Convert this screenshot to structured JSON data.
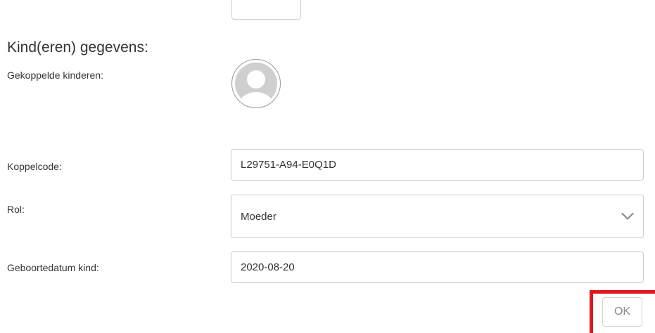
{
  "section": {
    "title": "Kind(eren) gegevens:"
  },
  "children": {
    "label": "Gekoppelde kinderen:",
    "avatar_icon": "default-user-avatar-icon"
  },
  "form": {
    "koppelcode": {
      "label": "Koppelcode:",
      "value": "L29751-A94-E0Q1D"
    },
    "rol": {
      "label": "Rol:",
      "selected": "Moeder",
      "icon": "chevron-down-icon"
    },
    "geboortedatum": {
      "label": "Geboortedatum kind:",
      "value": "2020-08-20"
    }
  },
  "actions": {
    "ok_label": "OK",
    "highlight_color": "#e0161e"
  }
}
